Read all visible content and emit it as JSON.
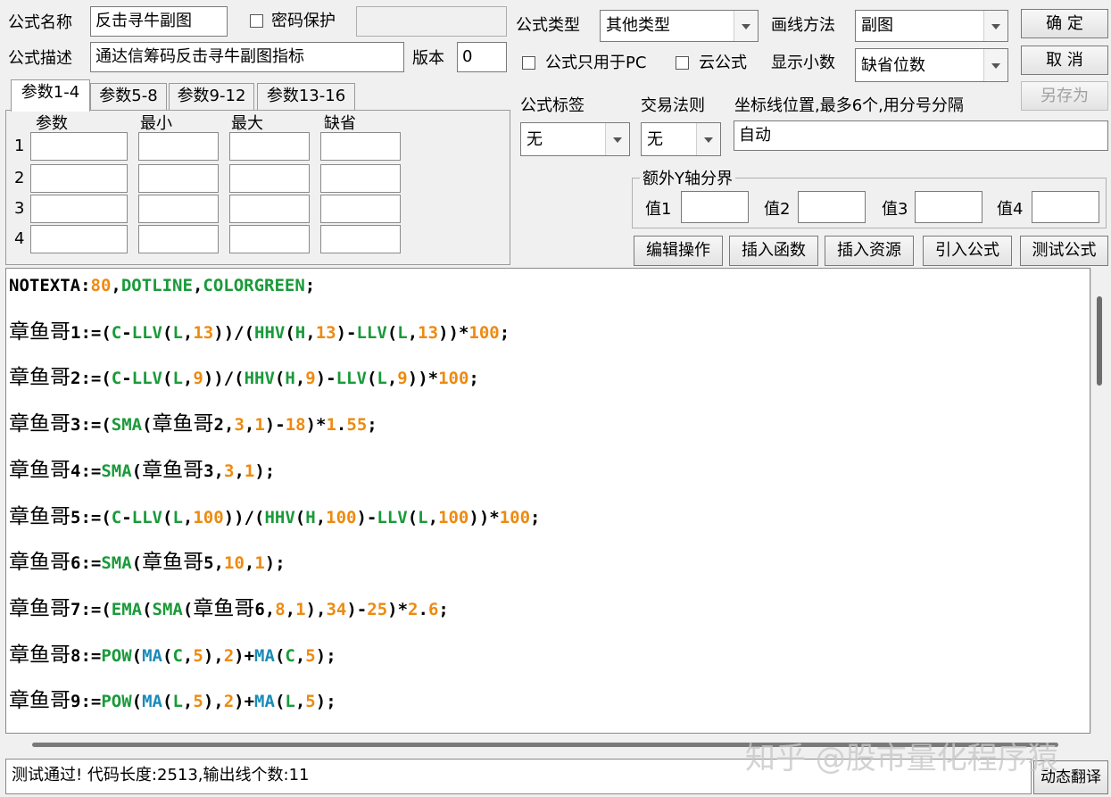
{
  "top": {
    "name_label": "公式名称",
    "name_value": "反击寻牛副图",
    "password_label": "密码保护",
    "desc_label": "公式描述",
    "desc_value": "通达信筹码反击寻牛副图指标",
    "version_label": "版本",
    "version_value": "0"
  },
  "settings": {
    "type_label": "公式类型",
    "type_value": "其他类型",
    "draw_label": "画线方法",
    "draw_value": "副图",
    "pc_only_label": "公式只用于PC",
    "cloud_label": "云公式",
    "decimals_label": "显示小数",
    "decimals_value": "缺省位数",
    "tag_label": "公式标签",
    "tag_value": "无",
    "rule_label": "交易法则",
    "rule_value": "无",
    "axis_label": "坐标线位置,最多6个,用分号分隔",
    "axis_value": "自动"
  },
  "buttons": {
    "ok": "确  定",
    "cancel": "取  消",
    "save_as": "另存为",
    "edit": "编辑操作",
    "insert_func": "插入函数",
    "insert_res": "插入资源",
    "import": "引入公式",
    "test": "测试公式",
    "translate": "动态翻译"
  },
  "tabs": [
    "参数1-4",
    "参数5-8",
    "参数9-12",
    "参数13-16"
  ],
  "params": {
    "headers": [
      "参数",
      "最小",
      "最大",
      "缺省"
    ],
    "rows": [
      "1",
      "2",
      "3",
      "4"
    ]
  },
  "yaxis": {
    "title": "额外Y轴分界",
    "labels": [
      "值1",
      "值2",
      "值3",
      "值4"
    ]
  },
  "colors": {
    "green": "#1a9a3a",
    "orange": "#ee8a10",
    "blue": "#1a8ab8",
    "black": "#000000"
  },
  "code_lines": [
    [
      [
        "NOTEXTA:",
        "k"
      ],
      [
        "80",
        "o"
      ],
      [
        ",",
        "k"
      ],
      [
        "DOTLINE",
        "g"
      ],
      [
        ",",
        "k"
      ],
      [
        "COLORGREEN",
        "g"
      ],
      [
        ";",
        "k"
      ]
    ],
    [
      [
        "章鱼哥",
        "c"
      ],
      [
        "1:=(",
        "k"
      ],
      [
        "C",
        "g"
      ],
      [
        "-",
        "k"
      ],
      [
        "LLV",
        "g"
      ],
      [
        "(",
        "k"
      ],
      [
        "L",
        "g"
      ],
      [
        ",",
        "k"
      ],
      [
        "13",
        "o"
      ],
      [
        "))/(",
        "k"
      ],
      [
        "HHV",
        "g"
      ],
      [
        "(",
        "k"
      ],
      [
        "H",
        "g"
      ],
      [
        ",",
        "k"
      ],
      [
        "13",
        "o"
      ],
      [
        ")-",
        "k"
      ],
      [
        "LLV",
        "g"
      ],
      [
        "(",
        "k"
      ],
      [
        "L",
        "g"
      ],
      [
        ",",
        "k"
      ],
      [
        "13",
        "o"
      ],
      [
        "))*",
        "k"
      ],
      [
        "100",
        "o"
      ],
      [
        ";",
        "k"
      ]
    ],
    [
      [
        "章鱼哥",
        "c"
      ],
      [
        "2:=(",
        "k"
      ],
      [
        "C",
        "g"
      ],
      [
        "-",
        "k"
      ],
      [
        "LLV",
        "g"
      ],
      [
        "(",
        "k"
      ],
      [
        "L",
        "g"
      ],
      [
        ",",
        "k"
      ],
      [
        "9",
        "o"
      ],
      [
        "))/(",
        "k"
      ],
      [
        "HHV",
        "g"
      ],
      [
        "(",
        "k"
      ],
      [
        "H",
        "g"
      ],
      [
        ",",
        "k"
      ],
      [
        "9",
        "o"
      ],
      [
        ")-",
        "k"
      ],
      [
        "LLV",
        "g"
      ],
      [
        "(",
        "k"
      ],
      [
        "L",
        "g"
      ],
      [
        ",",
        "k"
      ],
      [
        "9",
        "o"
      ],
      [
        "))*",
        "k"
      ],
      [
        "100",
        "o"
      ],
      [
        ";",
        "k"
      ]
    ],
    [
      [
        "章鱼哥",
        "c"
      ],
      [
        "3:=(",
        "k"
      ],
      [
        "SMA",
        "g"
      ],
      [
        "(",
        "k"
      ],
      [
        "章鱼哥",
        "c"
      ],
      [
        "2,",
        "k"
      ],
      [
        "3",
        "o"
      ],
      [
        ",",
        "k"
      ],
      [
        "1",
        "o"
      ],
      [
        ")-",
        "k"
      ],
      [
        "18",
        "o"
      ],
      [
        ")*",
        "k"
      ],
      [
        "1",
        "o"
      ],
      [
        ".",
        "k"
      ],
      [
        "55",
        "o"
      ],
      [
        ";",
        "k"
      ]
    ],
    [
      [
        "章鱼哥",
        "c"
      ],
      [
        "4:=",
        "k"
      ],
      [
        "SMA",
        "g"
      ],
      [
        "(",
        "k"
      ],
      [
        "章鱼哥",
        "c"
      ],
      [
        "3,",
        "k"
      ],
      [
        "3",
        "o"
      ],
      [
        ",",
        "k"
      ],
      [
        "1",
        "o"
      ],
      [
        ");",
        "k"
      ]
    ],
    [
      [
        "章鱼哥",
        "c"
      ],
      [
        "5:=(",
        "k"
      ],
      [
        "C",
        "g"
      ],
      [
        "-",
        "k"
      ],
      [
        "LLV",
        "g"
      ],
      [
        "(",
        "k"
      ],
      [
        "L",
        "g"
      ],
      [
        ",",
        "k"
      ],
      [
        "100",
        "o"
      ],
      [
        "))/(",
        "k"
      ],
      [
        "HHV",
        "g"
      ],
      [
        "(",
        "k"
      ],
      [
        "H",
        "g"
      ],
      [
        ",",
        "k"
      ],
      [
        "100",
        "o"
      ],
      [
        ")-",
        "k"
      ],
      [
        "LLV",
        "g"
      ],
      [
        "(",
        "k"
      ],
      [
        "L",
        "g"
      ],
      [
        ",",
        "k"
      ],
      [
        "100",
        "o"
      ],
      [
        "))*",
        "k"
      ],
      [
        "100",
        "o"
      ],
      [
        ";",
        "k"
      ]
    ],
    [
      [
        "章鱼哥",
        "c"
      ],
      [
        "6:=",
        "k"
      ],
      [
        "SMA",
        "g"
      ],
      [
        "(",
        "k"
      ],
      [
        "章鱼哥",
        "c"
      ],
      [
        "5,",
        "k"
      ],
      [
        "10",
        "o"
      ],
      [
        ",",
        "k"
      ],
      [
        "1",
        "o"
      ],
      [
        ");",
        "k"
      ]
    ],
    [
      [
        "章鱼哥",
        "c"
      ],
      [
        "7:=(",
        "k"
      ],
      [
        "EMA",
        "g"
      ],
      [
        "(",
        "k"
      ],
      [
        "SMA",
        "g"
      ],
      [
        "(",
        "k"
      ],
      [
        "章鱼哥",
        "c"
      ],
      [
        "6,",
        "k"
      ],
      [
        "8",
        "o"
      ],
      [
        ",",
        "k"
      ],
      [
        "1",
        "o"
      ],
      [
        "),",
        "k"
      ],
      [
        "34",
        "o"
      ],
      [
        ")-",
        "k"
      ],
      [
        "25",
        "o"
      ],
      [
        ")*",
        "k"
      ],
      [
        "2",
        "o"
      ],
      [
        ".",
        "k"
      ],
      [
        "6",
        "o"
      ],
      [
        ";",
        "k"
      ]
    ],
    [
      [
        "章鱼哥",
        "c"
      ],
      [
        "8:=",
        "k"
      ],
      [
        "POW",
        "g"
      ],
      [
        "(",
        "k"
      ],
      [
        "MA",
        "b"
      ],
      [
        "(",
        "k"
      ],
      [
        "C",
        "g"
      ],
      [
        ",",
        "k"
      ],
      [
        "5",
        "o"
      ],
      [
        "),",
        "k"
      ],
      [
        "2",
        "o"
      ],
      [
        ")+",
        "k"
      ],
      [
        "MA",
        "b"
      ],
      [
        "(",
        "k"
      ],
      [
        "C",
        "g"
      ],
      [
        ",",
        "k"
      ],
      [
        "5",
        "o"
      ],
      [
        ");",
        "k"
      ]
    ],
    [
      [
        "章鱼哥",
        "c"
      ],
      [
        "9:=",
        "k"
      ],
      [
        "POW",
        "g"
      ],
      [
        "(",
        "k"
      ],
      [
        "MA",
        "b"
      ],
      [
        "(",
        "k"
      ],
      [
        "L",
        "g"
      ],
      [
        ",",
        "k"
      ],
      [
        "5",
        "o"
      ],
      [
        "),",
        "k"
      ],
      [
        "2",
        "o"
      ],
      [
        ")+",
        "k"
      ],
      [
        "MA",
        "b"
      ],
      [
        "(",
        "k"
      ],
      [
        "L",
        "g"
      ],
      [
        ",",
        "k"
      ],
      [
        "5",
        "o"
      ],
      [
        ");",
        "k"
      ]
    ]
  ],
  "status": "测试通过! 代码长度:2513,输出线个数:11",
  "watermark": "知乎 @股市量化程序猿"
}
